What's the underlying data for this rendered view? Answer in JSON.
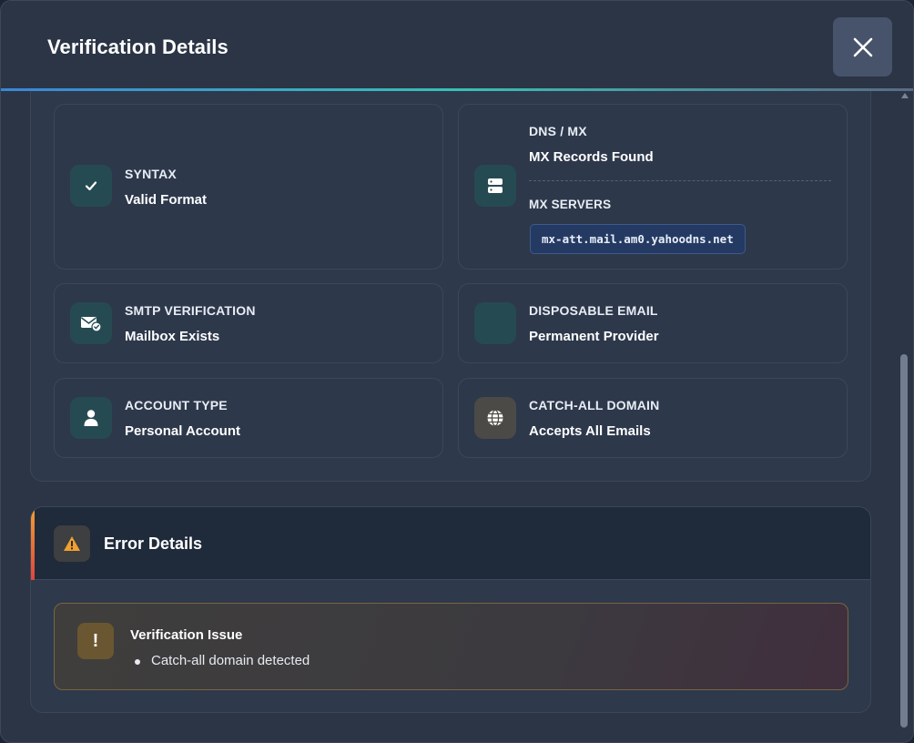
{
  "modal": {
    "title": "Verification Details"
  },
  "cards": {
    "syntax": {
      "label": "SYNTAX",
      "value": "Valid Format"
    },
    "dns": {
      "label": "DNS / MX",
      "value": "MX Records Found",
      "servers_label": "MX SERVERS",
      "servers": [
        "mx-att.mail.am0.yahoodns.net"
      ]
    },
    "smtp": {
      "label": "SMTP VERIFICATION",
      "value": "Mailbox Exists"
    },
    "disposable": {
      "label": "DISPOSABLE EMAIL",
      "value": "Permanent Provider"
    },
    "account": {
      "label": "ACCOUNT TYPE",
      "value": "Personal Account"
    },
    "catchall": {
      "label": "CATCH-ALL DOMAIN",
      "value": "Accepts All Emails"
    }
  },
  "error": {
    "title": "Error Details",
    "issue_title": "Verification Issue",
    "issues": [
      "Catch-all domain detected"
    ]
  },
  "colors": {
    "accent_teal": "#39c0b4",
    "accent_blue": "#3a86d8",
    "warning": "#f0a030"
  },
  "icons": {
    "close": "close-icon",
    "syntax": "check-icon",
    "dns": "server-icon",
    "smtp": "mail-check-icon",
    "account": "user-icon",
    "catchall": "globe-icon",
    "error": "warning-triangle-icon",
    "issue": "exclamation-icon"
  }
}
